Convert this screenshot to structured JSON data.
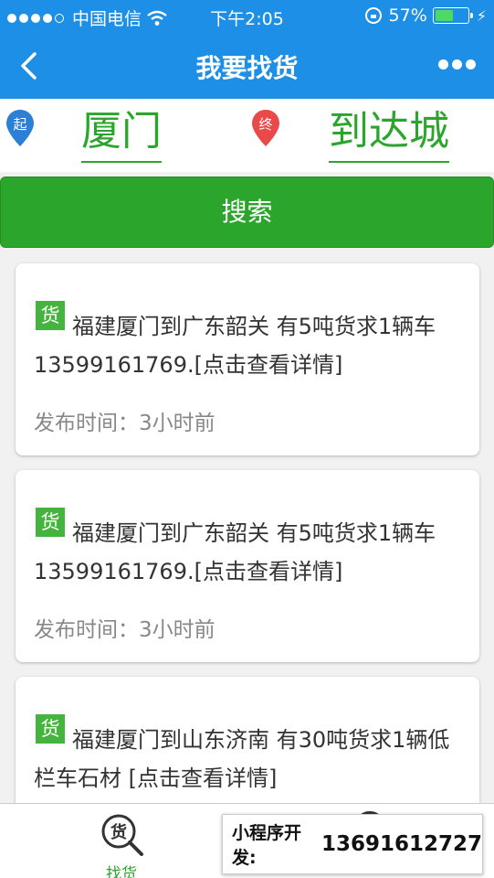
{
  "status_bar": {
    "carrier": "中国电信",
    "time": "下午2:05",
    "battery_percent_text": "57%",
    "battery_level": 0.57
  },
  "nav": {
    "title": "我要找货"
  },
  "route": {
    "origin_marker": "起",
    "origin_city": "厦门",
    "dest_marker": "终",
    "dest_city": "到达城"
  },
  "search_button": "搜索",
  "cards": [
    {
      "badge": "货",
      "description": "福建厦门到广东韶关 有5吨货求1辆车 13599161769.[点击查看详情]",
      "time_label": "发布时间：",
      "time_value": "3小时前"
    },
    {
      "badge": "货",
      "description": "福建厦门到广东韶关 有5吨货求1辆车 13599161769.[点击查看详情]",
      "time_label": "发布时间：",
      "time_value": "3小时前"
    },
    {
      "badge": "货",
      "description": "福建厦门到山东济南 有30吨货求1辆低栏车石材 [点击查看详情]"
    }
  ],
  "tab_bar": {
    "find_icon_char": "货",
    "find_label": "找货"
  },
  "promo": {
    "label": "小程序开发:",
    "phone": "13691612727"
  },
  "colors": {
    "header_blue": "#1e8fe6",
    "accent_green": "#2ba52b",
    "badge_green": "#45b43e",
    "origin_pin_blue": "#2b7fd4",
    "dest_pin_red": "#e84a4a"
  }
}
